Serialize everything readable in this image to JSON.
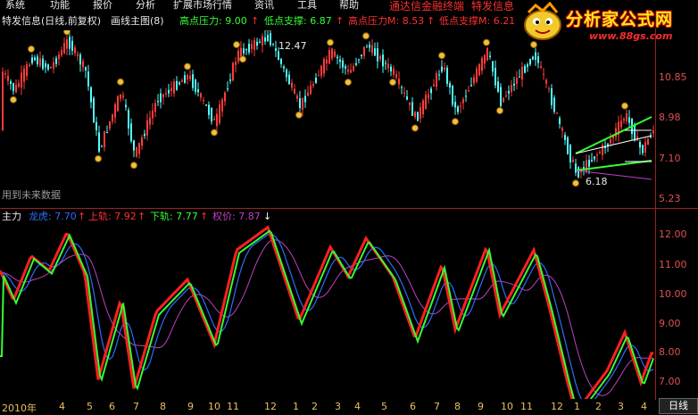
{
  "menu": {
    "items": [
      "系统",
      "功能",
      "报价",
      "分析",
      "扩展市场行情",
      "资讯",
      "工具",
      "帮助"
    ]
  },
  "ticker": {
    "text1": "通达信金融终端",
    "text2": "特发信息"
  },
  "logo": {
    "title": "分析家公式网",
    "url": "www.88gs.com"
  },
  "infobar": {
    "stock": "特发信息(日线,前复权)",
    "formula": "画线主图(8)",
    "high_press_label": "高点压力: 9.00",
    "low_support_label": "低点支撑: 6.87",
    "high_press_m_label": "高点压力M: 8.53",
    "low_support_m_label": "低点支撑M: 6.21",
    "arrow": "↑"
  },
  "main_panel": {
    "price_levels": [
      "10.85",
      "8.98",
      "7.10",
      "5.23"
    ],
    "high_mark": "12.47",
    "low_mark": "6.18",
    "footnote": "用到未来数据"
  },
  "sub_panel": {
    "name": "主力",
    "dragon_label": "龙虎: 7.70",
    "upper_label": "上轨: 7.92",
    "lower_label": "下轨: 7.77",
    "weight_label": "权价: 7.87",
    "up_arrow": "↑",
    "down_arrow": "↓",
    "levels": [
      "12.00",
      "11.00",
      "10.00",
      "9.00",
      "8.00",
      "7.00"
    ]
  },
  "xaxis": {
    "labels": [
      "2010年",
      "4",
      "5",
      "6",
      "7",
      "8",
      "9",
      "10",
      "11",
      "12",
      "1",
      "2",
      "3",
      "4",
      "5",
      "6",
      "7",
      "8",
      "9",
      "10",
      "11",
      "12",
      "1",
      "2",
      "3",
      "4"
    ],
    "tab": "日线"
  },
  "colors": {
    "background": "#000000",
    "up_candle": "#ff3c3c",
    "down_candle": "#54ffff",
    "green_line": "#33ff33",
    "red_line": "#ff2020",
    "blue_line": "#2f6bff",
    "magenta_line": "#c040c0",
    "gold": "#f0c040"
  }
}
